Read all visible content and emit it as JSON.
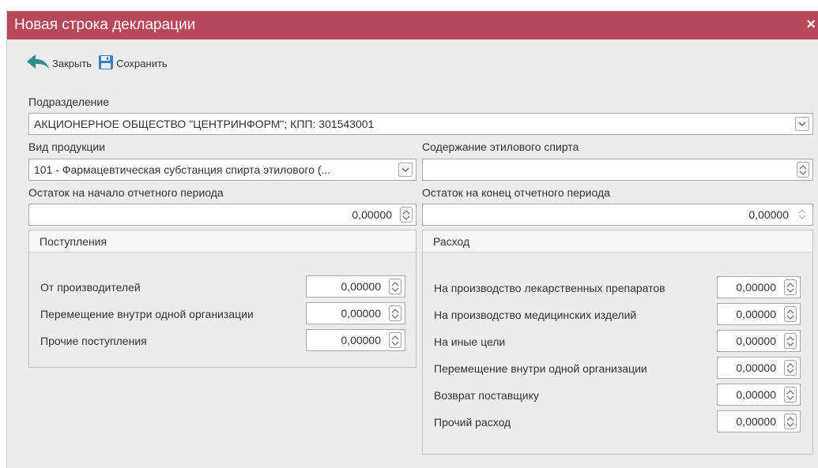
{
  "window": {
    "title": "Новая строка декларации",
    "close_glyph": "×"
  },
  "toolbar": {
    "close_label": "Закрыть",
    "save_label": "Сохранить"
  },
  "division": {
    "label": "Подразделение",
    "value": "АКЦИОНЕРНОЕ ОБЩЕСТВО \"ЦЕНТРИНФОРМ\"; КПП: 301543001"
  },
  "product_type": {
    "label": "Вид продукции",
    "value": "101 - Фармацевтическая субстанция спирта этилового (..."
  },
  "ethyl_content": {
    "label": "Содержание этилового спирта",
    "value": ""
  },
  "start_balance": {
    "label": "Остаток на начало отчетного периода",
    "value": "0,00000"
  },
  "end_balance": {
    "label": "Остаток на конец отчетного периода",
    "value": "0,00000"
  },
  "receipts": {
    "title": "Поступления",
    "rows": [
      {
        "label": "От производителей",
        "value": "0,00000"
      },
      {
        "label": "Перемещение внутри одной организации",
        "value": "0,00000"
      },
      {
        "label": "Прочие поступления",
        "value": "0,00000"
      }
    ]
  },
  "expense": {
    "title": "Расход",
    "rows": [
      {
        "label": "На производство лекарственных препаратов",
        "value": "0,00000"
      },
      {
        "label": "На производство медицинских изделий",
        "value": "0,00000"
      },
      {
        "label": "На иные цели",
        "value": "0,00000"
      },
      {
        "label": "Перемещение внутри одной организации",
        "value": "0,00000"
      },
      {
        "label": "Возврат поставщику",
        "value": "0,00000"
      },
      {
        "label": "Прочий расход",
        "value": "0,00000"
      }
    ]
  },
  "colors": {
    "titlebar": "#b7485a",
    "back_arrow": "#2f8f8a",
    "save_icon": "#3d7fc1"
  },
  "icons": {
    "close": "close-icon",
    "back": "back-arrow-icon",
    "save": "floppy-disk-icon",
    "dropdown": "chevron-down-icon",
    "spin": "spin-updown-icon"
  }
}
